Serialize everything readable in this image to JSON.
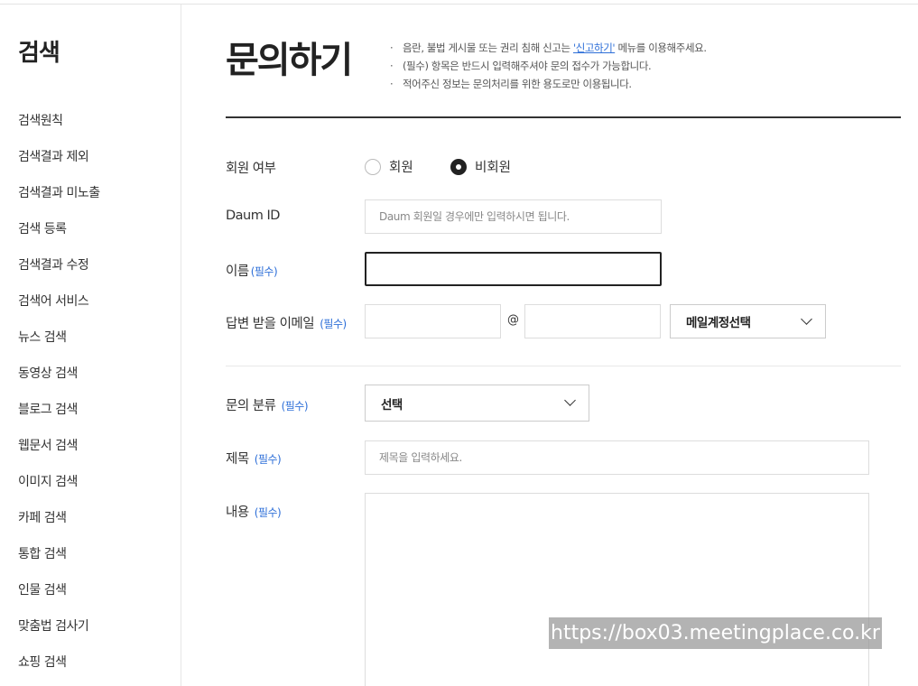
{
  "sidebar": {
    "title": "검색",
    "items": [
      {
        "label": "검색원칙"
      },
      {
        "label": "검색결과 제외"
      },
      {
        "label": "검색결과 미노출"
      },
      {
        "label": "검색 등록"
      },
      {
        "label": "검색결과 수정"
      },
      {
        "label": "검색어 서비스"
      },
      {
        "label": "뉴스 검색"
      },
      {
        "label": "동영상 검색"
      },
      {
        "label": "블로그 검색"
      },
      {
        "label": "웹문서 검색"
      },
      {
        "label": "이미지 검색"
      },
      {
        "label": "카페 검색"
      },
      {
        "label": "통합 검색"
      },
      {
        "label": "인물 검색"
      },
      {
        "label": "맞춤법 검사기"
      },
      {
        "label": "쇼핑 검색"
      }
    ]
  },
  "header": {
    "title": "문의하기",
    "notices": {
      "line1_before": "음란, 불법 게시물 또는 권리 침해 신고는 ",
      "line1_link": "'신고하기'",
      "line1_after": " 메뉴를 이용해주세요.",
      "line2": "(필수) 항목은 반드시 입력해주셔야 문의 접수가 가능합니다.",
      "line3": "적어주신 정보는 문의처리를 위한 용도로만 이용됩니다."
    }
  },
  "form": {
    "required_tag": "(필수)",
    "member": {
      "label": "회원 여부",
      "options": [
        "회원",
        "비회원"
      ],
      "selected": "비회원"
    },
    "daum_id": {
      "label": "Daum ID",
      "placeholder": "Daum 회원일 경우에만 입력하시면 됩니다."
    },
    "name": {
      "label": "이름",
      "value": ""
    },
    "email": {
      "label": "답변 받을 이메일",
      "at": "@",
      "domain_select": "메일계정선택"
    },
    "category": {
      "label": "문의 분류",
      "selected": "선택"
    },
    "subject": {
      "label": "제목",
      "placeholder": "제목을 입력하세요."
    },
    "content": {
      "label": "내용",
      "value": ""
    }
  },
  "overlay": {
    "url_text": "https://box03.meetingplace.co.kr"
  }
}
